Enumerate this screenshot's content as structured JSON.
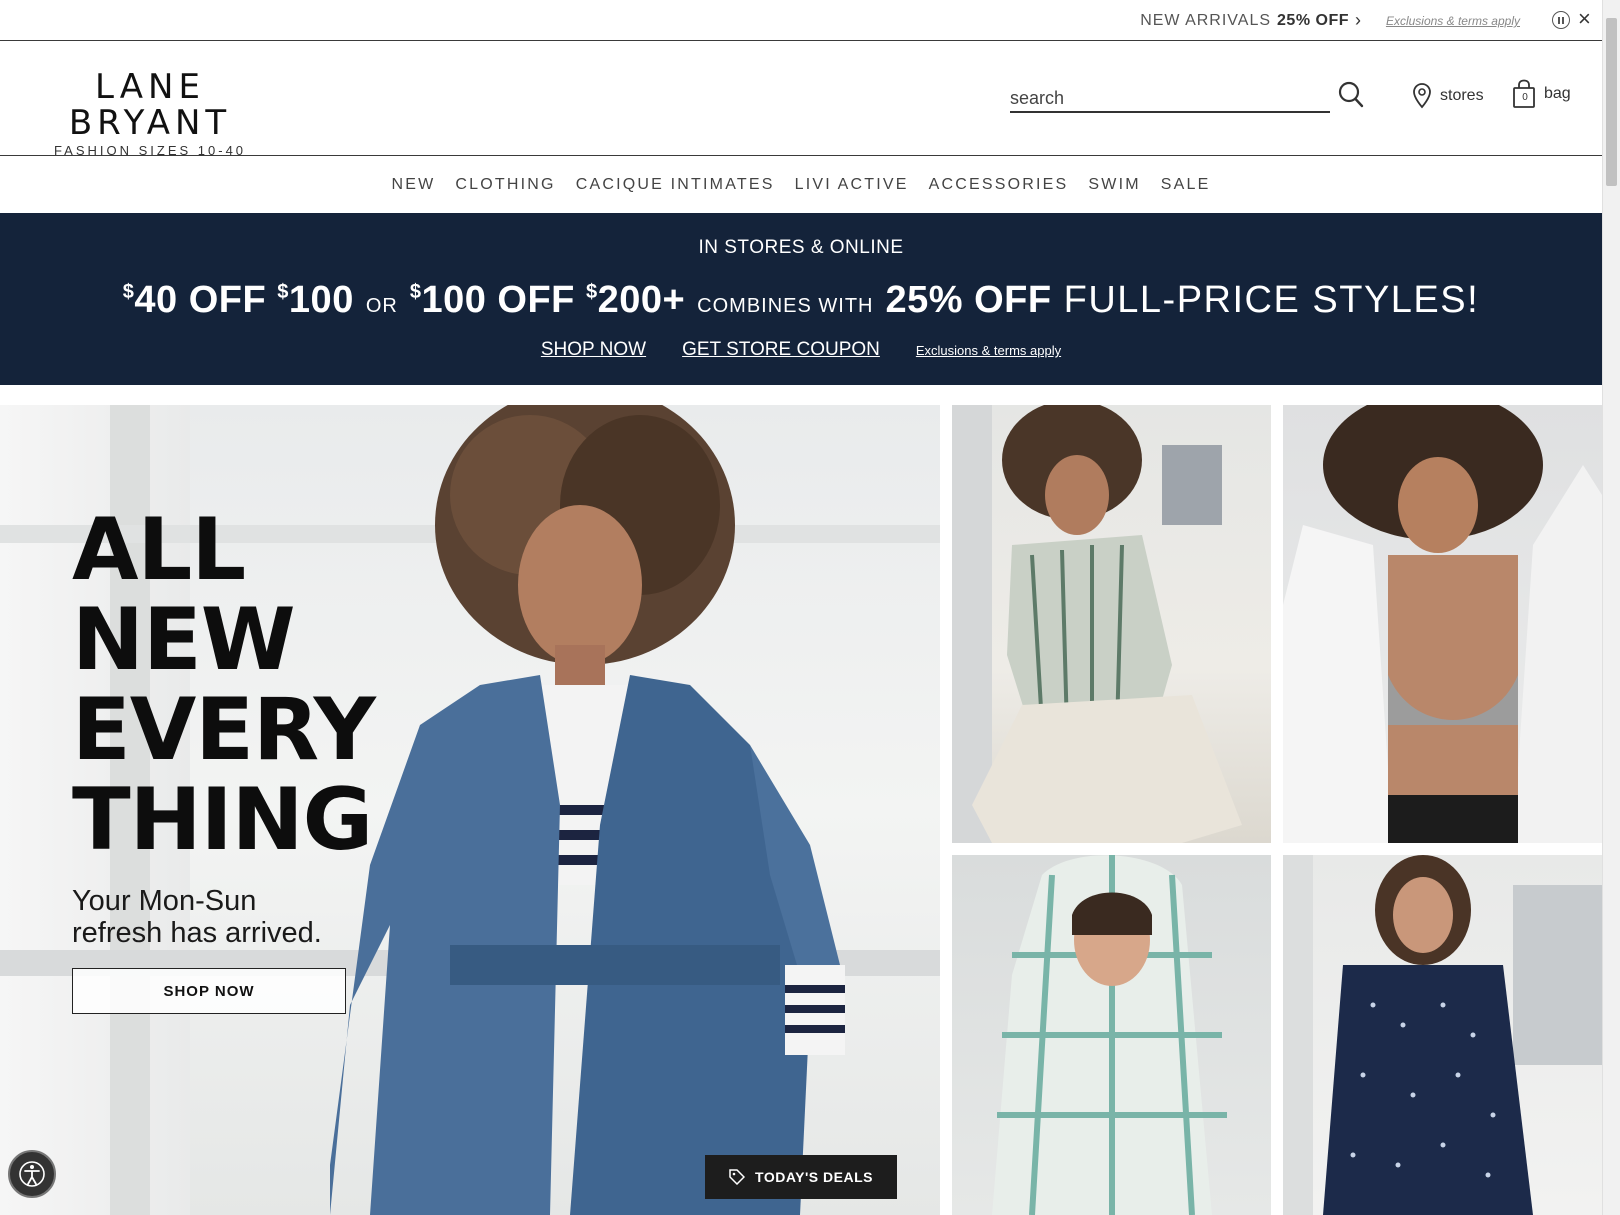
{
  "topbar": {
    "promo_lead": "NEW ARRIVALS",
    "promo_bold": "25% OFF",
    "promo_chevron": "›",
    "terms": "Exclusions & terms apply",
    "close": "×"
  },
  "header": {
    "logo_brand": "LANE BRYANT",
    "logo_sub": "FASHION SIZES 10-40",
    "search_placeholder": "search",
    "stores_label": "stores",
    "bag_label": "bag",
    "bag_count": "0"
  },
  "nav": {
    "items": [
      "NEW",
      "CLOTHING",
      "CACIQUE INTIMATES",
      "LIVI ACTIVE",
      "ACCESSORIES",
      "SWIM",
      "SALE"
    ]
  },
  "banner": {
    "line1": "IN STORES & ONLINE",
    "dollar": "$",
    "offer1_a": "40 OFF ",
    "offer1_b": "100",
    "or": "OR",
    "offer2_a": "100 OFF ",
    "offer2_b": "200+",
    "combines": "COMBINES WITH",
    "pct": "25% OFF",
    "fullprice": "FULL-PRICE STYLES!",
    "shop_now": "SHOP NOW",
    "get_coupon": "GET STORE COUPON",
    "terms": "Exclusions & terms apply",
    "bg_color": "#14233a"
  },
  "hero": {
    "title_lines": [
      "ALL",
      "NEW",
      "EVERY",
      "THING"
    ],
    "subtitle_1": "Your Mon-Sun",
    "subtitle_2": "refresh has arrived.",
    "cta": "SHOP NOW"
  },
  "floating": {
    "deals": "TODAY'S DEALS"
  },
  "icons": {
    "search": "search-icon",
    "stores": "location-pin-icon",
    "bag": "shopping-bag-icon",
    "pause": "pause-icon",
    "close": "close-icon",
    "tag": "tag-icon",
    "accessibility": "accessibility-icon"
  }
}
